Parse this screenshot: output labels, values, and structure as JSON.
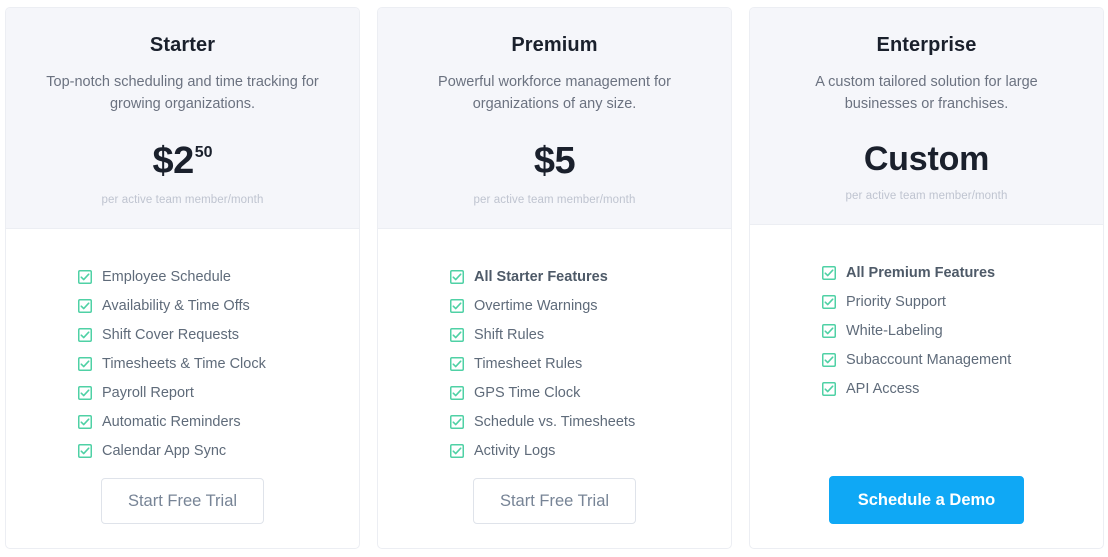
{
  "accent_colors": {
    "primary_button": "#0fa8f5",
    "check_icon": "#4fd1a5",
    "header_bg": "#f5f6fa",
    "card_border": "#eceef3",
    "title_text": "#1a202c",
    "body_text": "#6b7280",
    "price_note_text": "#bfc4d0"
  },
  "plans": [
    {
      "name": "Starter",
      "description": "Top-notch scheduling and time tracking for growing organizations.",
      "price_main": "$2",
      "price_sup": "50",
      "price_note": "per active team member/month",
      "features": [
        {
          "label": "Employee Schedule",
          "highlight": false
        },
        {
          "label": "Availability & Time Offs",
          "highlight": false
        },
        {
          "label": "Shift Cover Requests",
          "highlight": false
        },
        {
          "label": "Timesheets & Time Clock",
          "highlight": false
        },
        {
          "label": "Payroll Report",
          "highlight": false
        },
        {
          "label": "Automatic Reminders",
          "highlight": false
        },
        {
          "label": "Calendar App Sync",
          "highlight": false
        }
      ],
      "cta_label": "Start Free Trial",
      "cta_style": "outline"
    },
    {
      "name": "Premium",
      "description": "Powerful workforce management for organizations of any size.",
      "price_main": "$5",
      "price_sup": "",
      "price_note": "per active team member/month",
      "features": [
        {
          "label": "All Starter Features",
          "highlight": true
        },
        {
          "label": "Overtime Warnings",
          "highlight": false
        },
        {
          "label": "Shift Rules",
          "highlight": false
        },
        {
          "label": "Timesheet Rules",
          "highlight": false
        },
        {
          "label": "GPS Time Clock",
          "highlight": false
        },
        {
          "label": "Schedule vs. Timesheets",
          "highlight": false
        },
        {
          "label": "Activity Logs",
          "highlight": false
        }
      ],
      "cta_label": "Start Free Trial",
      "cta_style": "outline"
    },
    {
      "name": "Enterprise",
      "description": "A custom tailored solution for large businesses or franchises.",
      "price_main": "Custom",
      "price_sup": "",
      "price_note": "per active team member/month",
      "features": [
        {
          "label": "All Premium Features",
          "highlight": true
        },
        {
          "label": "Priority Support",
          "highlight": false
        },
        {
          "label": "White-Labeling",
          "highlight": false
        },
        {
          "label": "Subaccount Management",
          "highlight": false
        },
        {
          "label": "API Access",
          "highlight": false
        }
      ],
      "cta_label": "Schedule a Demo",
      "cta_style": "primary"
    }
  ],
  "icons": {
    "check": "checkbox-checked-icon"
  }
}
